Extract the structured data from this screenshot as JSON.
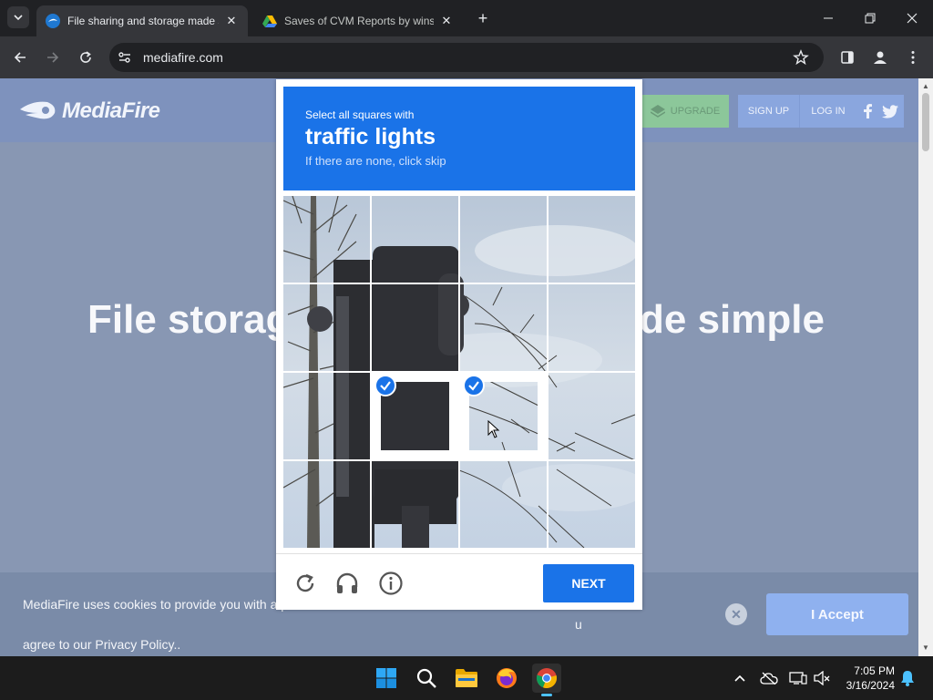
{
  "browser": {
    "tabs": [
      {
        "title": "File sharing and storage made s",
        "active": true
      },
      {
        "title": "Saves of CVM Reports by winse",
        "active": false
      }
    ],
    "new_tab_label": "+",
    "url": "mediafire.com"
  },
  "mediafire": {
    "logo_text": "MediaFire",
    "upgrade_label": "UPGRADE",
    "signup_label": "SIGN UP",
    "login_label": "LOG IN",
    "hero_left": "File storag",
    "hero_right": "de simple",
    "cookie_text": "MediaFire uses cookies to provide you with a personalized browsing experience. By continuing to use this site, you agree to our Privacy Policy..",
    "cookie_text_visible_start": "MediaFire uses cookies to provide you with a p",
    "cookie_text_visible_end": "u",
    "cookie_text_line2": "agree to our Privacy Policy..",
    "accept_label": "I Accept",
    "colors": {
      "accept": "#8fb1ef",
      "upgrade": "#8cc79a",
      "nav": "#8aa6de"
    }
  },
  "captcha": {
    "instruction": "Select all squares with",
    "target": "traffic lights",
    "skip_hint": "If there are none, click skip",
    "next_label": "NEXT",
    "selected_tiles": [
      [
        2,
        1
      ],
      [
        2,
        2
      ]
    ],
    "accent": "#1a73e8"
  },
  "taskbar": {
    "time": "7:05 PM",
    "date": "3/16/2024",
    "apps": [
      "windows-start",
      "search",
      "file-explorer",
      "firefox",
      "chrome"
    ]
  }
}
